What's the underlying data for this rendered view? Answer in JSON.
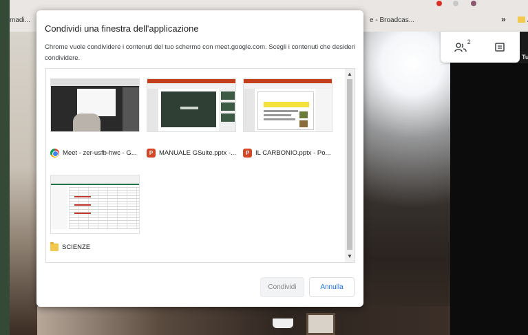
{
  "browser": {
    "bookmark_left": "madi...",
    "bookmark_right": "e - Broadcas...",
    "bookmark_chevron": "»",
    "bookmark_extra": "Al"
  },
  "meet": {
    "participants_count": "2",
    "self_label": "Tu"
  },
  "dialog": {
    "title": "Condividi una finestra dell'applicazione",
    "description": "Chrome vuole condividere i contenuti del tuo schermo con meet.google.com. Scegli i contenuti che desideri condividere.",
    "windows": [
      {
        "label": "Meet - zer-usfb-hwc - G...",
        "icon": "chrome-icon"
      },
      {
        "label": "MANUALE GSuite.pptx -...",
        "icon": "powerpoint-icon"
      },
      {
        "label": "IL CARBONIO.pptx - Po...",
        "icon": "powerpoint-icon"
      },
      {
        "label": "SCIENZE",
        "icon": "folder-icon"
      }
    ],
    "share_button": "Condividi",
    "cancel_button": "Annulla"
  },
  "colors": {
    "accent": "#1a73e8",
    "powerpoint": "#d24726",
    "excel": "#217346"
  }
}
